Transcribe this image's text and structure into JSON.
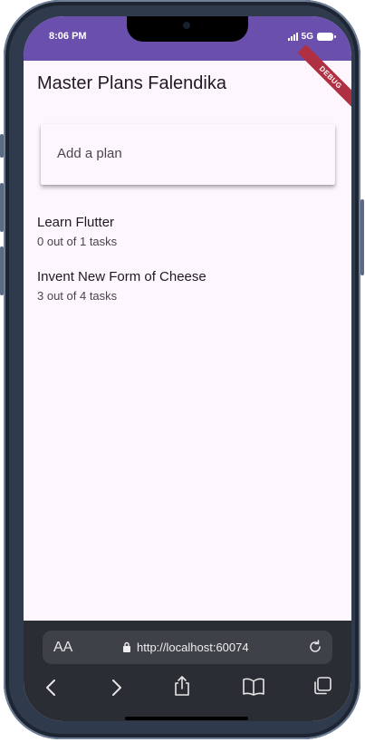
{
  "status_bar": {
    "time": "8:06 PM",
    "network": "5G",
    "color": "#6a4fad"
  },
  "debug_banner": "DEBUG",
  "app": {
    "title": "Master Plans Falendika",
    "add_plan_placeholder": "Add a plan",
    "plans": [
      {
        "name": "Learn Flutter",
        "progress": "0 out of 1 tasks"
      },
      {
        "name": "Invent New Form of Cheese",
        "progress": "3 out of 4 tasks"
      }
    ]
  },
  "browser": {
    "text_size_label": "AA",
    "url": "http://localhost:60074",
    "icons": [
      "lock-icon",
      "reload-icon",
      "back-icon",
      "forward-icon",
      "share-icon",
      "bookmarks-icon",
      "tabs-icon"
    ]
  }
}
